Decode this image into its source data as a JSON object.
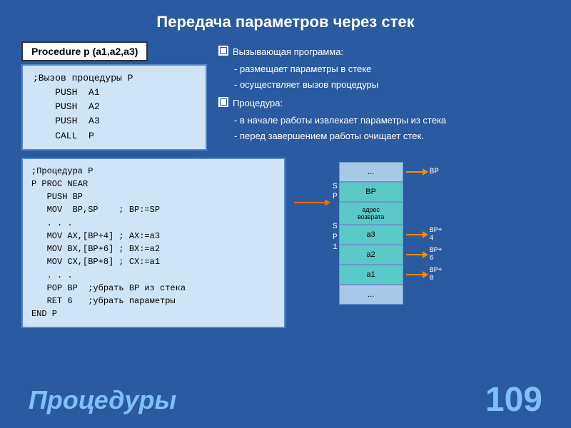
{
  "page": {
    "title": "Передача параметров через стек",
    "background_color": "#2a5aa0"
  },
  "procedure_header": {
    "label": "Procedure p (a1,a2,a3)"
  },
  "top_code": {
    "lines": [
      ";Вызов процедуры P",
      "    PUSH  A1",
      "    PUSH  A2",
      "    PUSH  A3",
      "    CALL  P"
    ]
  },
  "description": {
    "items": [
      {
        "icon": "checkbox",
        "text": "Вызывающая программа:"
      }
    ],
    "sub1": [
      "- размещает параметры в стеке",
      "- осуществляет вызов процедуры"
    ],
    "items2": [
      {
        "icon": "checkbox",
        "text": "Процедура:"
      }
    ],
    "sub2": [
      "- в начале работы извлекает параметры из стека",
      "- перед завершением работы очищает стек."
    ]
  },
  "bottom_code": {
    "lines": [
      ";Процедура P",
      "P PROC NEAR",
      "   PUSH BP",
      "   MOV  BP,SP    ; BP:=SP",
      "   . . .",
      "   MOV AX,[BP+4] ; AX:=a3",
      "   MOV BX,[BP+6] ; BX:=a2",
      "   MOV CX,[BP+8] ; CX:=a1",
      "   . . .",
      "   POP BP  ;убрать BP из стека",
      "   RET 6   ;убрать параметры",
      "END P"
    ]
  },
  "stack": {
    "sp_label": "S\nP\nS\nP\n1",
    "cells": [
      {
        "label": "...",
        "class": "cell-empty"
      },
      {
        "label": "BP",
        "class": "cell-bp"
      },
      {
        "label": "адрес возвра та",
        "class": "cell-addr"
      },
      {
        "label": "a3",
        "class": "cell-a3"
      },
      {
        "label": "a2",
        "class": "cell-a2"
      },
      {
        "label": "a1",
        "class": "cell-a1"
      },
      {
        "label": "...",
        "class": "cell-dots"
      }
    ],
    "right_labels": [
      "BP",
      "",
      "BP+\n4\nBP+\n6\nBP+\n8",
      "",
      "",
      "",
      ""
    ]
  },
  "footer": {
    "title": "Процедуры",
    "page": "109"
  }
}
